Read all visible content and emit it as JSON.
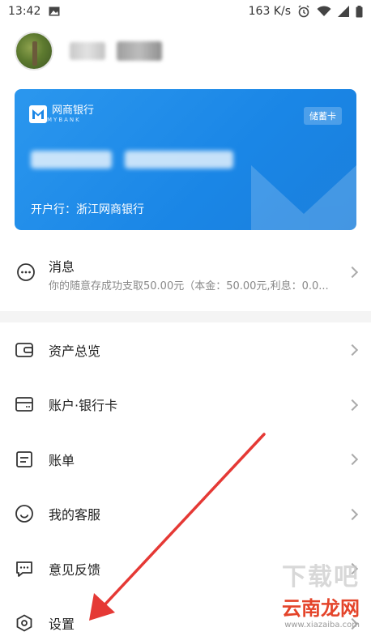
{
  "status_bar": {
    "time": "13:42",
    "speed": "163 K/s"
  },
  "card": {
    "bank_name": "网商银行",
    "bank_name_en": "MYBANK",
    "card_type": "储蓄卡",
    "open_bank": "开户行：浙江网商银行",
    "accent_color": "#1a86e6"
  },
  "message": {
    "title": "消息",
    "subtitle": "你的随意存成功支取50.00元（本金：50.00元,利息：0.0..."
  },
  "menu": [
    {
      "label": "资产总览",
      "icon": "wallet-icon"
    },
    {
      "label": "账户·银行卡",
      "icon": "card-icon"
    },
    {
      "label": "账单",
      "icon": "bill-icon"
    },
    {
      "label": "我的客服",
      "icon": "service-icon"
    },
    {
      "label": "意见反馈",
      "icon": "feedback-icon"
    },
    {
      "label": "设置",
      "icon": "settings-icon"
    }
  ],
  "watermark": {
    "big": "下载吧",
    "brand": "云南龙网",
    "url": "www.xiazaiba.com"
  },
  "annotation_color": "#e53935"
}
